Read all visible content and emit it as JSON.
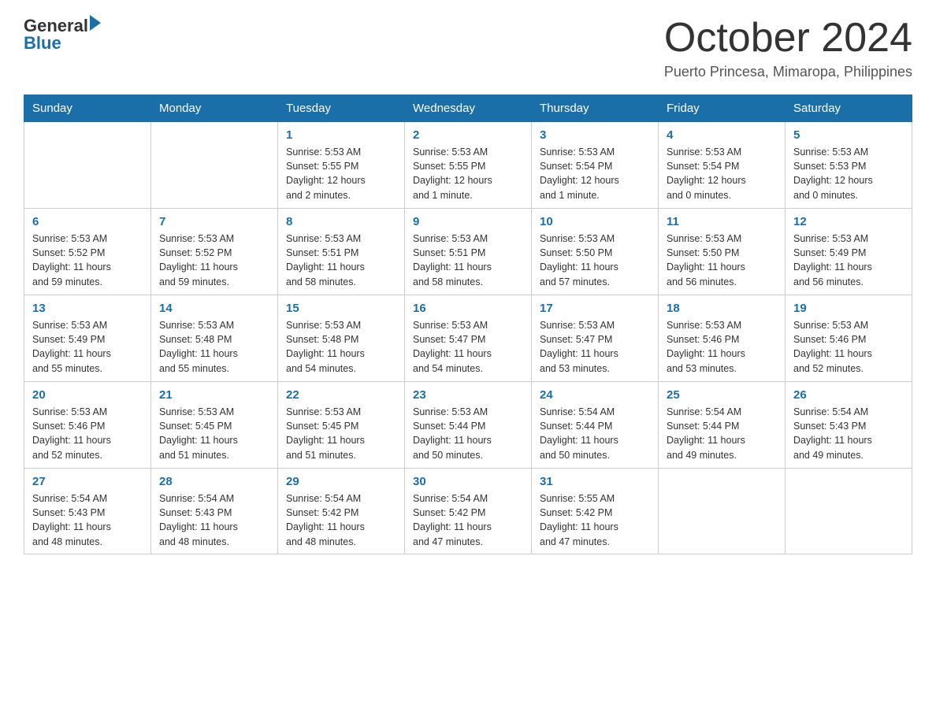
{
  "header": {
    "logo_general": "General",
    "logo_blue": "Blue",
    "title": "October 2024",
    "subtitle": "Puerto Princesa, Mimaropa, Philippines"
  },
  "weekdays": [
    "Sunday",
    "Monday",
    "Tuesday",
    "Wednesday",
    "Thursday",
    "Friday",
    "Saturday"
  ],
  "weeks": [
    [
      {
        "day": "",
        "info": ""
      },
      {
        "day": "",
        "info": ""
      },
      {
        "day": "1",
        "info": "Sunrise: 5:53 AM\nSunset: 5:55 PM\nDaylight: 12 hours\nand 2 minutes."
      },
      {
        "day": "2",
        "info": "Sunrise: 5:53 AM\nSunset: 5:55 PM\nDaylight: 12 hours\nand 1 minute."
      },
      {
        "day": "3",
        "info": "Sunrise: 5:53 AM\nSunset: 5:54 PM\nDaylight: 12 hours\nand 1 minute."
      },
      {
        "day": "4",
        "info": "Sunrise: 5:53 AM\nSunset: 5:54 PM\nDaylight: 12 hours\nand 0 minutes."
      },
      {
        "day": "5",
        "info": "Sunrise: 5:53 AM\nSunset: 5:53 PM\nDaylight: 12 hours\nand 0 minutes."
      }
    ],
    [
      {
        "day": "6",
        "info": "Sunrise: 5:53 AM\nSunset: 5:52 PM\nDaylight: 11 hours\nand 59 minutes."
      },
      {
        "day": "7",
        "info": "Sunrise: 5:53 AM\nSunset: 5:52 PM\nDaylight: 11 hours\nand 59 minutes."
      },
      {
        "day": "8",
        "info": "Sunrise: 5:53 AM\nSunset: 5:51 PM\nDaylight: 11 hours\nand 58 minutes."
      },
      {
        "day": "9",
        "info": "Sunrise: 5:53 AM\nSunset: 5:51 PM\nDaylight: 11 hours\nand 58 minutes."
      },
      {
        "day": "10",
        "info": "Sunrise: 5:53 AM\nSunset: 5:50 PM\nDaylight: 11 hours\nand 57 minutes."
      },
      {
        "day": "11",
        "info": "Sunrise: 5:53 AM\nSunset: 5:50 PM\nDaylight: 11 hours\nand 56 minutes."
      },
      {
        "day": "12",
        "info": "Sunrise: 5:53 AM\nSunset: 5:49 PM\nDaylight: 11 hours\nand 56 minutes."
      }
    ],
    [
      {
        "day": "13",
        "info": "Sunrise: 5:53 AM\nSunset: 5:49 PM\nDaylight: 11 hours\nand 55 minutes."
      },
      {
        "day": "14",
        "info": "Sunrise: 5:53 AM\nSunset: 5:48 PM\nDaylight: 11 hours\nand 55 minutes."
      },
      {
        "day": "15",
        "info": "Sunrise: 5:53 AM\nSunset: 5:48 PM\nDaylight: 11 hours\nand 54 minutes."
      },
      {
        "day": "16",
        "info": "Sunrise: 5:53 AM\nSunset: 5:47 PM\nDaylight: 11 hours\nand 54 minutes."
      },
      {
        "day": "17",
        "info": "Sunrise: 5:53 AM\nSunset: 5:47 PM\nDaylight: 11 hours\nand 53 minutes."
      },
      {
        "day": "18",
        "info": "Sunrise: 5:53 AM\nSunset: 5:46 PM\nDaylight: 11 hours\nand 53 minutes."
      },
      {
        "day": "19",
        "info": "Sunrise: 5:53 AM\nSunset: 5:46 PM\nDaylight: 11 hours\nand 52 minutes."
      }
    ],
    [
      {
        "day": "20",
        "info": "Sunrise: 5:53 AM\nSunset: 5:46 PM\nDaylight: 11 hours\nand 52 minutes."
      },
      {
        "day": "21",
        "info": "Sunrise: 5:53 AM\nSunset: 5:45 PM\nDaylight: 11 hours\nand 51 minutes."
      },
      {
        "day": "22",
        "info": "Sunrise: 5:53 AM\nSunset: 5:45 PM\nDaylight: 11 hours\nand 51 minutes."
      },
      {
        "day": "23",
        "info": "Sunrise: 5:53 AM\nSunset: 5:44 PM\nDaylight: 11 hours\nand 50 minutes."
      },
      {
        "day": "24",
        "info": "Sunrise: 5:54 AM\nSunset: 5:44 PM\nDaylight: 11 hours\nand 50 minutes."
      },
      {
        "day": "25",
        "info": "Sunrise: 5:54 AM\nSunset: 5:44 PM\nDaylight: 11 hours\nand 49 minutes."
      },
      {
        "day": "26",
        "info": "Sunrise: 5:54 AM\nSunset: 5:43 PM\nDaylight: 11 hours\nand 49 minutes."
      }
    ],
    [
      {
        "day": "27",
        "info": "Sunrise: 5:54 AM\nSunset: 5:43 PM\nDaylight: 11 hours\nand 48 minutes."
      },
      {
        "day": "28",
        "info": "Sunrise: 5:54 AM\nSunset: 5:43 PM\nDaylight: 11 hours\nand 48 minutes."
      },
      {
        "day": "29",
        "info": "Sunrise: 5:54 AM\nSunset: 5:42 PM\nDaylight: 11 hours\nand 48 minutes."
      },
      {
        "day": "30",
        "info": "Sunrise: 5:54 AM\nSunset: 5:42 PM\nDaylight: 11 hours\nand 47 minutes."
      },
      {
        "day": "31",
        "info": "Sunrise: 5:55 AM\nSunset: 5:42 PM\nDaylight: 11 hours\nand 47 minutes."
      },
      {
        "day": "",
        "info": ""
      },
      {
        "day": "",
        "info": ""
      }
    ]
  ]
}
